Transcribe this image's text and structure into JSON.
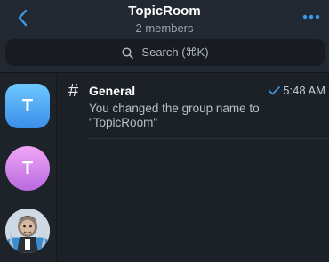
{
  "header": {
    "title": "TopicRoom",
    "subtitle": "2 members"
  },
  "search": {
    "label": "Search (⌘K)"
  },
  "sidebar": {
    "avatars": [
      {
        "letter": "T",
        "color_top": "#6ec8ff",
        "color_bottom": "#3a8eea"
      },
      {
        "letter": "T",
        "color_top": "#f1a6f5",
        "color_bottom": "#b86ae0"
      },
      {
        "kind": "photo"
      }
    ]
  },
  "chats": [
    {
      "name": "General",
      "message": "You changed the group name to \"TopicRoom\"",
      "time": "5:48 AM",
      "status": "sent-check"
    }
  ],
  "colors": {
    "accent": "#3a9bea",
    "background": "#1c2128",
    "header": "#222831"
  }
}
